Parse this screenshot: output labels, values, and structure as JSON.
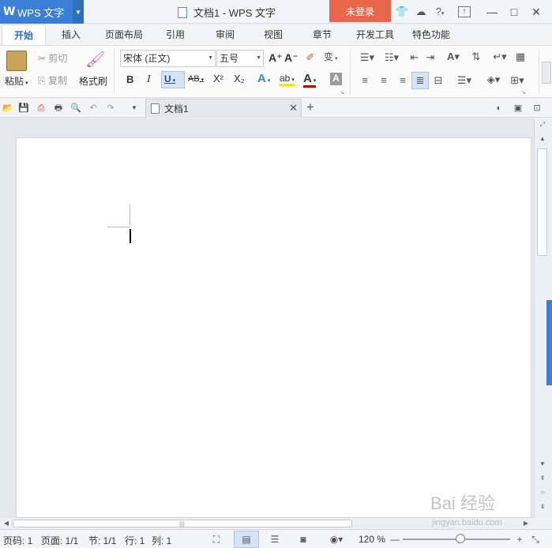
{
  "app": {
    "name": "WPS 文字",
    "logo": "W"
  },
  "window": {
    "title": "文档1 - WPS 文字",
    "login_label": "未登录",
    "help_label": "?"
  },
  "menu": {
    "tabs": [
      {
        "label": "开始"
      },
      {
        "label": "插入"
      },
      {
        "label": "页面布局"
      },
      {
        "label": "引用"
      },
      {
        "label": "审阅"
      },
      {
        "label": "视图"
      },
      {
        "label": "章节"
      },
      {
        "label": "开发工具"
      },
      {
        "label": "特色功能"
      }
    ]
  },
  "ribbon": {
    "paste_label": "粘贴",
    "cut_label": "剪切",
    "copy_label": "复制",
    "format_painter_label": "格式刷",
    "font_name": "宋体 (正文)",
    "font_size": "五号",
    "bold": "B",
    "italic": "I",
    "underline": "U",
    "strike": "AB",
    "superscript": "X²",
    "subscript": "X₂",
    "grow_font": "A⁺",
    "shrink_font": "A⁻",
    "phonetic": "变",
    "font_color": "A",
    "char_shade": "A",
    "text_effect": "A",
    "highlight": "ab"
  },
  "doc_tabs": {
    "active_label": "文档1"
  },
  "statusbar": {
    "page_code": "页码: 1",
    "page": "页面: 1/1",
    "section": "节: 1/1",
    "row": "行: 1",
    "col": "列: 1",
    "zoom": "120 %"
  },
  "watermark": {
    "text": "Bai 经验",
    "sub": "jingyan.baidu.com"
  },
  "colors": {
    "accent": "#3b80d6",
    "login_bg": "#e8674a"
  }
}
